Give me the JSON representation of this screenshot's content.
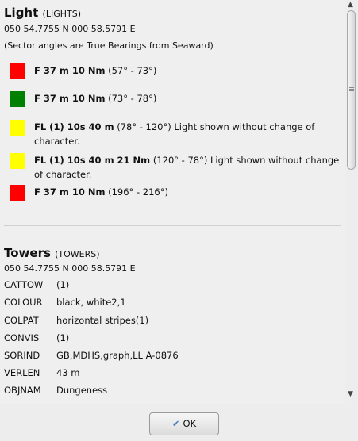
{
  "light": {
    "title": "Light",
    "code": "(LIGHTS)",
    "position": "050 54.7755 N 000 58.5791 E",
    "note": "(Sector angles are True Bearings from Seaward)",
    "sectors": [
      {
        "color": "#ff0000",
        "bold": "F 37 m 10 Nm",
        "rest": " (57° - 73°)"
      },
      {
        "color": "#008000",
        "bold": "F 37 m 10 Nm",
        "rest": " (73° - 78°)"
      },
      {
        "color": "#ffff00",
        "bold": "FL (1) 10s 40 m",
        "rest": " (78° - 120°) Light shown without change of character."
      },
      {
        "color": "#ffff00",
        "bold": "FL (1) 10s 40 m 21 Nm",
        "rest": " (120° - 78°) Light shown without change of character."
      },
      {
        "color": "#ff0000",
        "bold": "F 37 m 10 Nm",
        "rest": " (196° - 216°)"
      }
    ]
  },
  "towers": {
    "title": "Towers",
    "code": "(TOWERS)",
    "position": "050 54.7755 N 000 58.5791 E",
    "attributes": [
      {
        "key": "CATTOW",
        "value": "(1)"
      },
      {
        "key": "COLOUR",
        "value": "black, white2,1"
      },
      {
        "key": "COLPAT",
        "value": "horizontal stripes(1)"
      },
      {
        "key": "CONVIS",
        "value": "(1)"
      },
      {
        "key": "SORIND",
        "value": "GB,MDHS,graph,LL A-0876"
      },
      {
        "key": "VERLEN",
        "value": "43 m"
      },
      {
        "key": "OBJNAM",
        "value": "Dungeness"
      }
    ]
  },
  "ok_button": {
    "label": "OK",
    "icon": "check-icon"
  },
  "scrollbar": {
    "up_icon": "▲",
    "down_icon": "▼"
  }
}
